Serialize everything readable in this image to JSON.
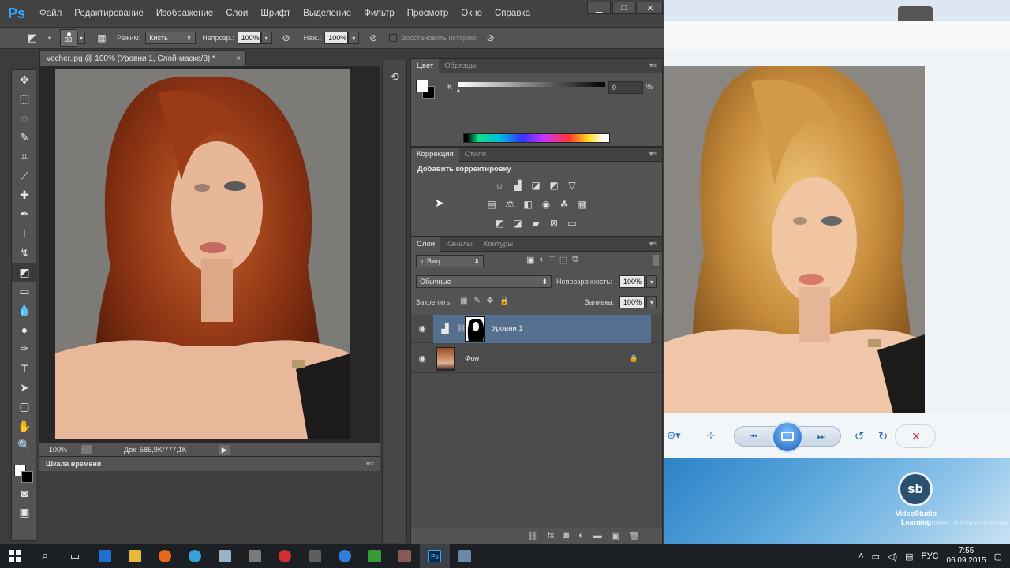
{
  "app": {
    "logo": "Ps"
  },
  "menu": [
    "Файл",
    "Редактирование",
    "Изображение",
    "Слои",
    "Шрифт",
    "Выделение",
    "Фильтр",
    "Просмотр",
    "Окно",
    "Справка"
  ],
  "window_controls": {
    "minimize": "▁",
    "maximize": "□",
    "close": "✕"
  },
  "options_bar": {
    "brush_size": "30",
    "mode_label": "Режим:",
    "mode_value": "Кисть",
    "opacity_label": "Непрозр.:",
    "opacity_value": "100%",
    "pressure_label": "Наж.:",
    "pressure_value": "100%",
    "restore_history_label": "Восстановить историю"
  },
  "document": {
    "tab_title": "vecher.jpg @ 100% (Уровни 1, Слой-маска/8) *",
    "tab_close": "×",
    "zoom": "100%",
    "doc_info": "Док: 585,9K/777,1K"
  },
  "timeline": {
    "title": "Шкала времени"
  },
  "color_panel": {
    "tabs": [
      "Цвет",
      "Образцы"
    ],
    "channel_label": "K",
    "channel_value": "0",
    "unit": "%"
  },
  "adjustments_panel": {
    "tabs": [
      "Коррекция",
      "Стили"
    ],
    "heading": "Добавить корректировку",
    "row1": [
      "brightness-icon",
      "levels-icon",
      "curves-icon",
      "exposure-icon",
      "gradient-triangle-icon"
    ],
    "row2": [
      "vibrance-icon",
      "balance-icon",
      "bw-icon",
      "photo-filter-icon",
      "channel-mixer-icon",
      "color-lookup-icon"
    ],
    "row3": [
      "invert-icon",
      "posterize-icon",
      "threshold-icon",
      "selective-color-icon",
      "gradient-map-icon"
    ]
  },
  "layers_panel": {
    "tabs": [
      "Слои",
      "Каналы",
      "Контуры"
    ],
    "filter_kind": "Вид",
    "blend_mode": "Обычные",
    "opacity_label": "Непрозрачность:",
    "opacity_value": "100%",
    "lock_label": "Закрепить:",
    "fill_label": "Заливка:",
    "fill_value": "100%",
    "layers": [
      {
        "name": "Уровни 1",
        "selected": true
      },
      {
        "name": "Фон",
        "selected": false
      }
    ]
  },
  "viewer": {
    "watermark_brand": "VideoStudio Learning",
    "watermark_text": "Windows 10 Insider Preview"
  },
  "taskbar": {
    "lang": "РУС",
    "time": "7:55",
    "date": "06.09.2015"
  },
  "colors": {
    "ps_accent": "#31a8ff",
    "selected_layer": "#55708f",
    "panel": "#535353"
  }
}
